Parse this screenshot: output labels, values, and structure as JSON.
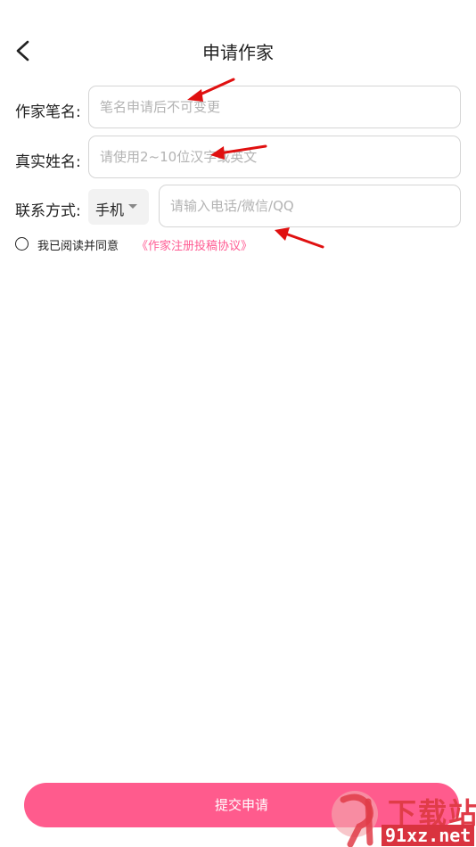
{
  "header": {
    "title": "申请作家",
    "back_icon": "chevron-left-icon"
  },
  "form": {
    "pen_name": {
      "label": "作家笔名:",
      "placeholder": "笔名申请后不可变更"
    },
    "real_name": {
      "label": "真实姓名:",
      "placeholder": "请使用2~10位汉字或英文"
    },
    "contact": {
      "label": "联系方式:",
      "type_selected": "手机",
      "placeholder": "请输入电话/微信/QQ"
    }
  },
  "agreement": {
    "text": "我已阅读并同意",
    "link": "《作家注册投稿协议》"
  },
  "submit_label": "提交申请",
  "watermark": {
    "title": "下载站",
    "url": "91xz.net"
  },
  "colors": {
    "accent": "#ff5b8d",
    "link": "#ff5c93",
    "annotation_arrow": "#e01010"
  }
}
